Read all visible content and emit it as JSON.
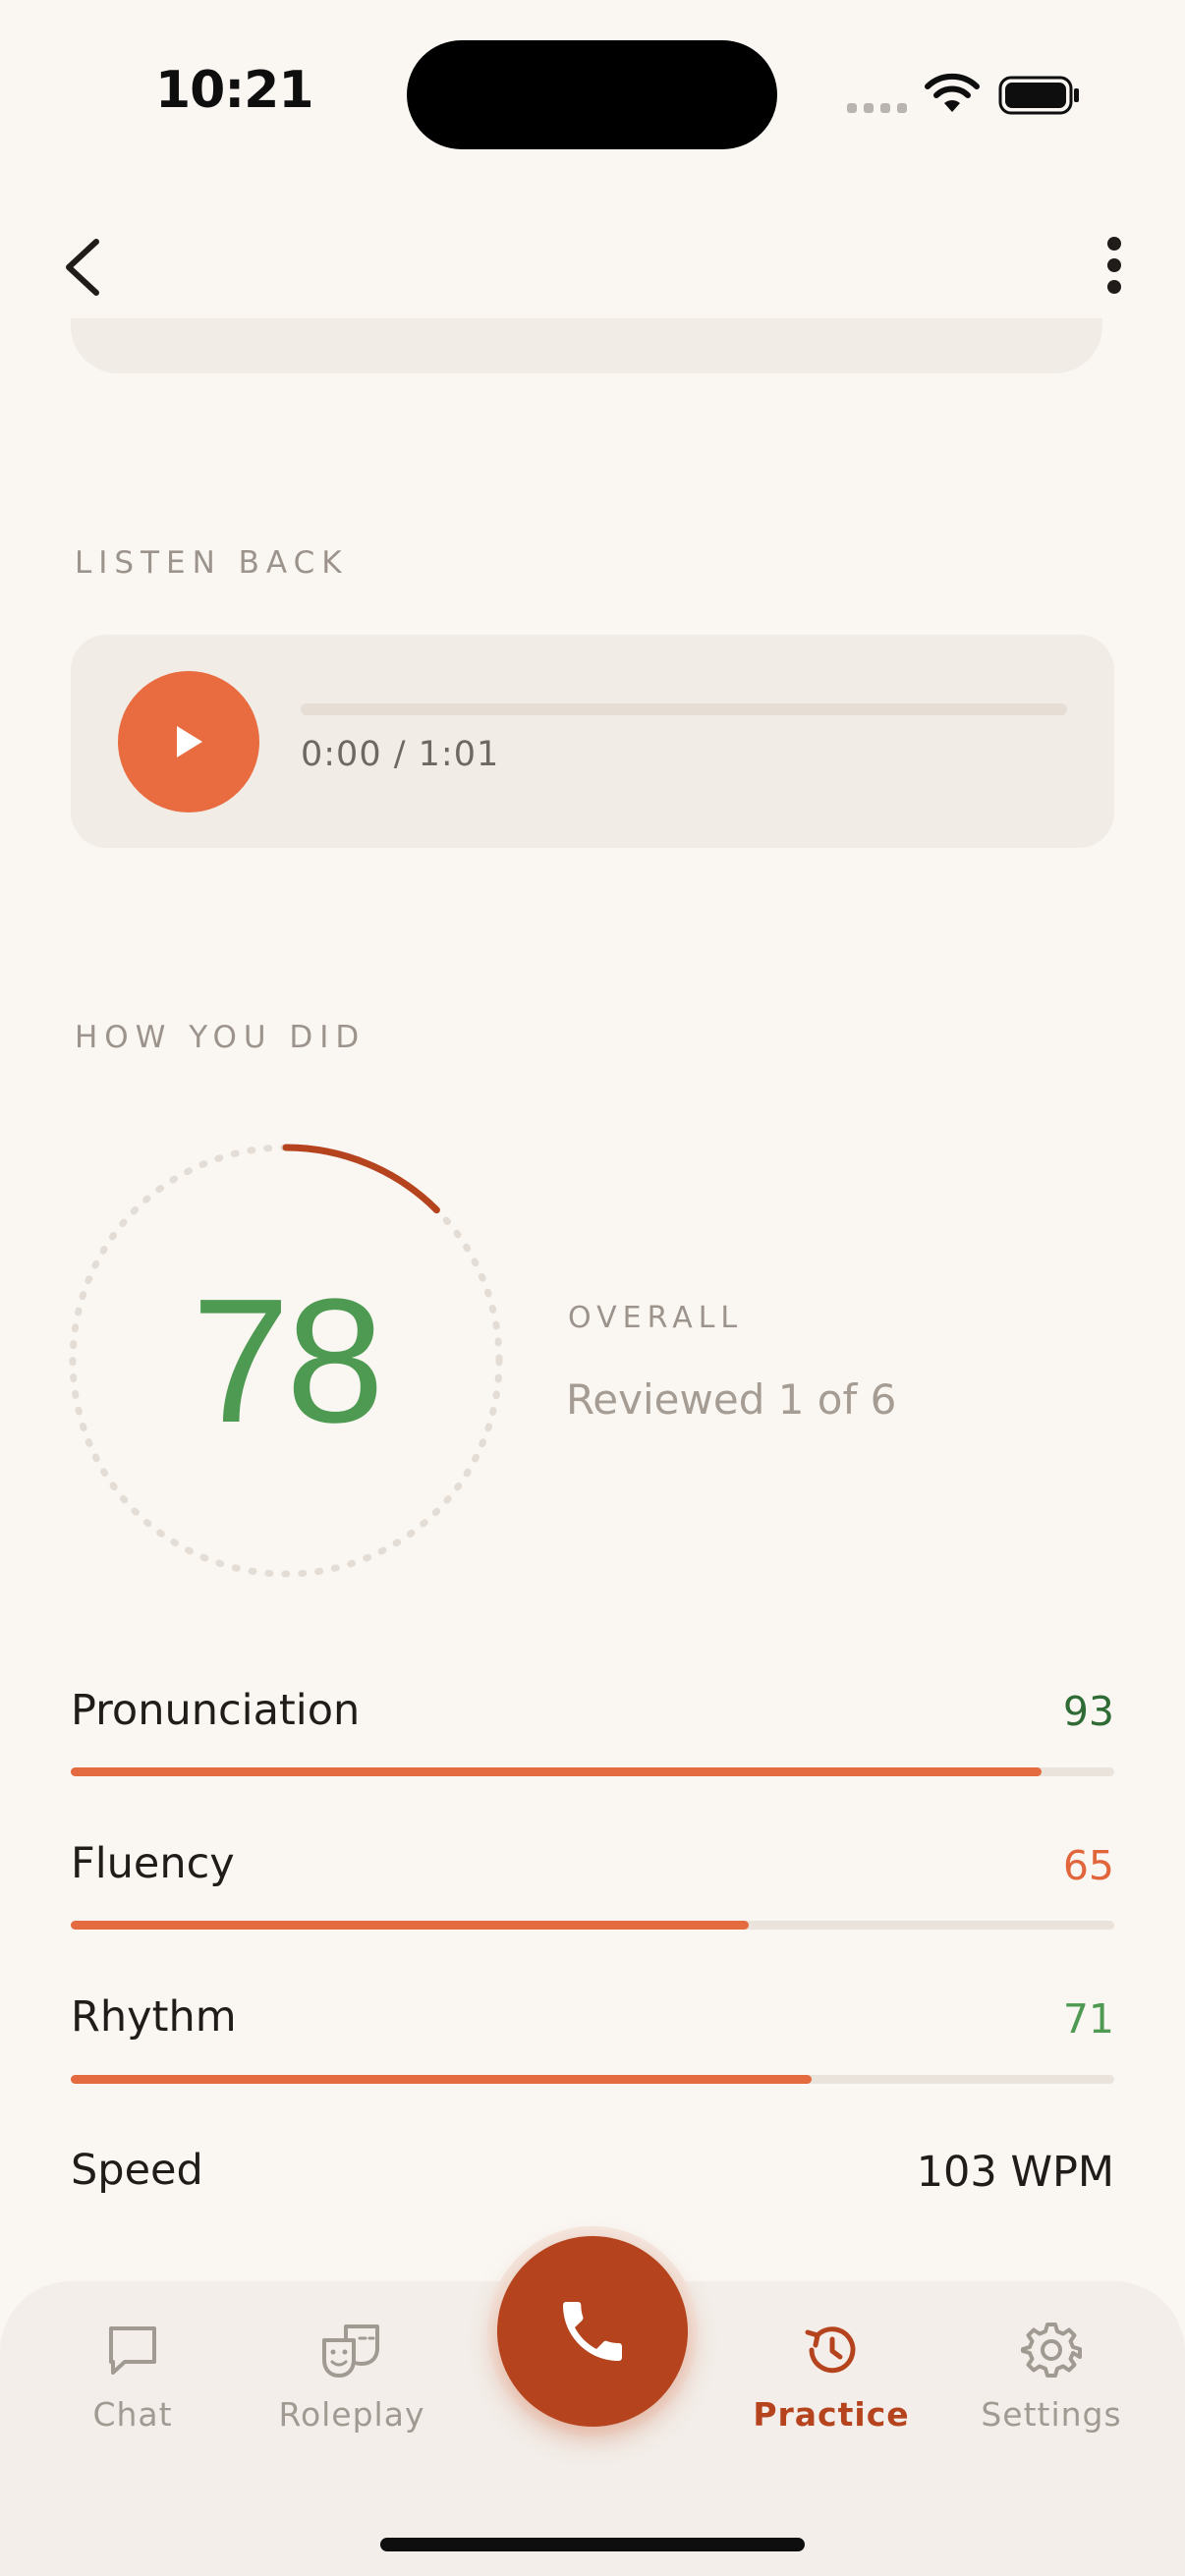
{
  "status_bar": {
    "time": "10:21"
  },
  "sections": {
    "listen_back_label": "LISTEN BACK",
    "how_you_did_label": "HOW YOU DID"
  },
  "audio": {
    "time_readout": "0:00 / 1:01",
    "progress": 0
  },
  "score": {
    "value": "78",
    "label": "OVERALL",
    "reviewed": "Reviewed 1 of 6",
    "ring_progress": 0.125
  },
  "metrics": [
    {
      "name": "Pronunciation",
      "value": "93",
      "fill": 0.93,
      "value_color": "#2F6B34"
    },
    {
      "name": "Fluency",
      "value": "65",
      "fill": 0.65,
      "value_color": "#E2663C"
    },
    {
      "name": "Rhythm",
      "value": "71",
      "fill": 0.71,
      "value_color": "#4E9A52"
    },
    {
      "name": "Speed",
      "value": "103 WPM"
    }
  ],
  "tabs": [
    {
      "label": "Chat",
      "icon": "chat-bubble-icon",
      "active": false
    },
    {
      "label": "Roleplay",
      "icon": "theater-masks-icon",
      "active": false
    },
    {
      "label": "Practice",
      "icon": "history-clock-icon",
      "active": true
    },
    {
      "label": "Settings",
      "icon": "gear-icon",
      "active": false
    }
  ],
  "colors": {
    "accent": "#E86C40",
    "accent_dark": "#B5441E",
    "score_green": "#4E9A52",
    "background": "#FAF7F3"
  }
}
